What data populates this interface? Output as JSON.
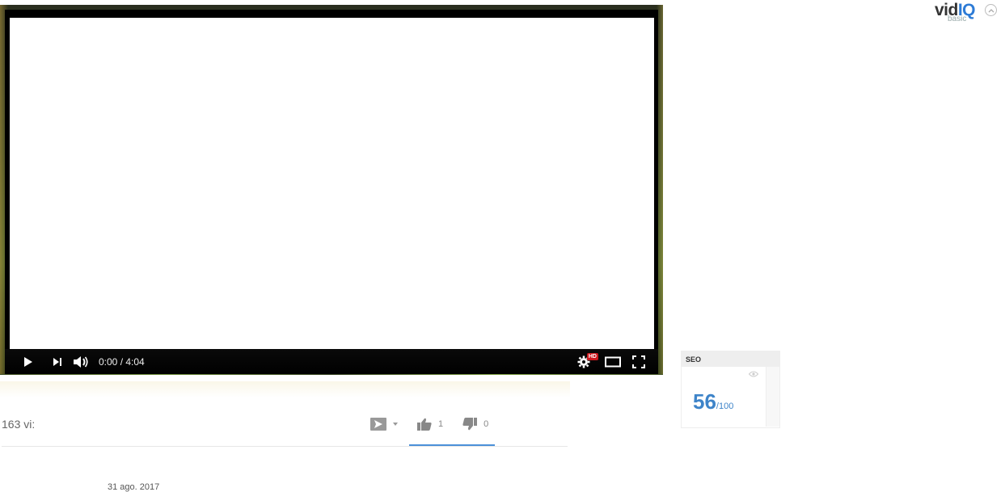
{
  "player": {
    "time_display": "0:00 / 4:04",
    "hd_badge": "HD"
  },
  "info": {
    "views": "163 vi:",
    "like_count": "1",
    "dislike_count": "0",
    "published_date": "31 ago. 2017"
  },
  "vidiq": {
    "brand_main": "vid",
    "brand_accent": "IQ",
    "plan": "basic",
    "seo_label": "SEO",
    "seo_score": "56",
    "seo_max": "/100"
  },
  "colors": {
    "accent_blue": "#4b90d9",
    "seo_blue": "#3e84c9",
    "hd_red": "#cc181e"
  }
}
